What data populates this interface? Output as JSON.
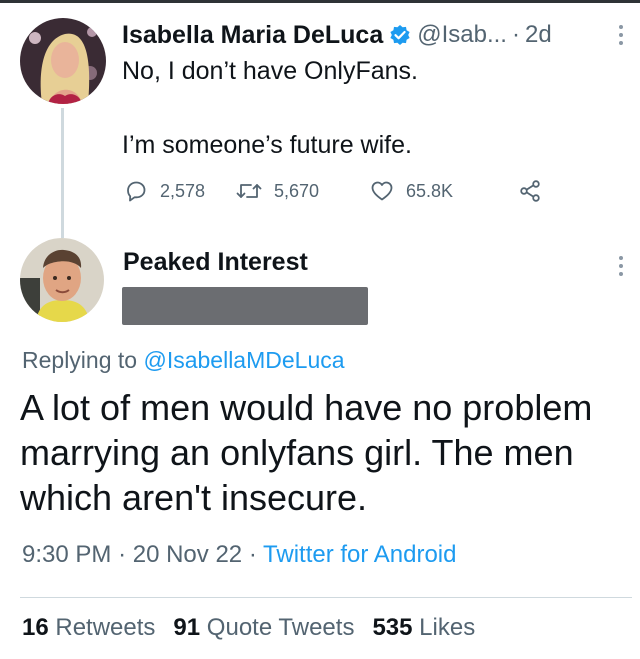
{
  "parent_tweet": {
    "author_name": "Isabella Maria DeLuca",
    "handle": "@Isab...",
    "separator": "·",
    "time": "2d",
    "text_line_1": "No, I don’t have OnlyFans.",
    "text_line_2": "I’m someone’s future wife.",
    "actions": {
      "replies": "2,578",
      "retweets": "5,670",
      "likes": "65.8K"
    },
    "icons": [
      "verified-badge-icon",
      "reply-icon",
      "retweet-icon",
      "like-icon",
      "share-icon",
      "more-icon"
    ]
  },
  "reply_tweet": {
    "author_name": "Peaked Interest",
    "replying_to_prefix": "Replying to",
    "replying_to_handle": "@IsabellaMDeLuca",
    "text": "A lot of men would have no problem marrying an onlyfans girl. The men which aren't insecure.",
    "time": "9:30 PM",
    "separator": "·",
    "date": "20 Nov 22",
    "source": "Twitter for Android",
    "stats": {
      "retweets_count": "16",
      "retweets_label": "Retweets",
      "quote_count": "91",
      "quote_label": "Quote Tweets",
      "likes_count": "535",
      "likes_label": "Likes"
    }
  },
  "colors": {
    "accent": "#1d9bf0",
    "secondary_text": "#536471",
    "primary_text": "#0f1419",
    "redaction": "#6b6d71"
  }
}
